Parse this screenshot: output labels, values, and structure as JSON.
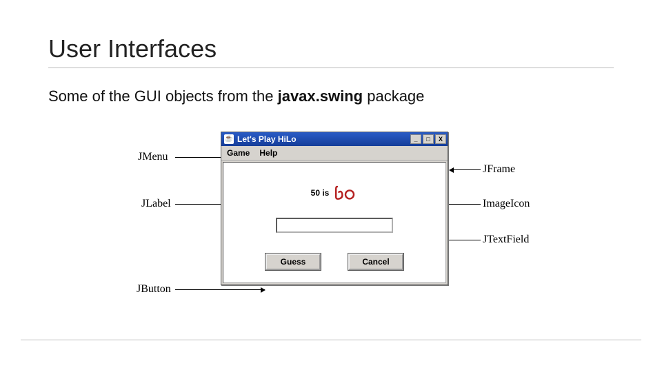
{
  "slide": {
    "title": "User Interfaces",
    "subtitle_prefix": "Some of the GUI objects from the ",
    "subtitle_package": "javax.swing",
    "subtitle_suffix": " package"
  },
  "window": {
    "title": "Let's Play HiLo",
    "menu": {
      "game": "Game",
      "help": "Help"
    },
    "message": "50 is",
    "icon_word": "lo",
    "buttons": {
      "guess": "Guess",
      "cancel": "Cancel"
    },
    "controls": {
      "min": "_",
      "max": "□",
      "close": "X"
    },
    "java_glyph": "☕"
  },
  "annotations": {
    "jmenu": "JMenu",
    "jlabel": "JLabel",
    "jbutton": "JButton",
    "jframe": "JFrame",
    "imageicon": "ImageIcon",
    "jtextfield": "JTextField"
  }
}
